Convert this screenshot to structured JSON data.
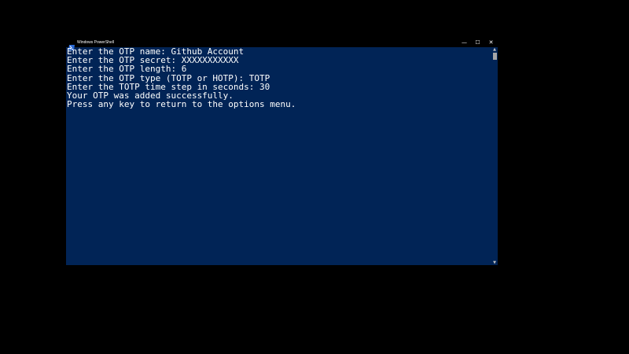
{
  "window": {
    "title": "Windows PowerShell",
    "controls": {
      "minimize": "—",
      "maximize": "☐",
      "close": "✕"
    }
  },
  "console": {
    "lines": [
      "Enter the OTP name: Github Account",
      "Enter the OTP secret: XXXXXXXXXXX",
      "Enter the OTP length: 6",
      "Enter the OTP type (TOTP or HOTP): TOTP",
      "Enter the TOTP time step in seconds: 30",
      "Your OTP was added successfully.",
      "Press any key to return to the options menu."
    ]
  },
  "scrollbar": {
    "up": "▲",
    "down": "▼"
  },
  "colors": {
    "background": "#012456",
    "text": "#ffffff",
    "titlebar": "#000000"
  }
}
